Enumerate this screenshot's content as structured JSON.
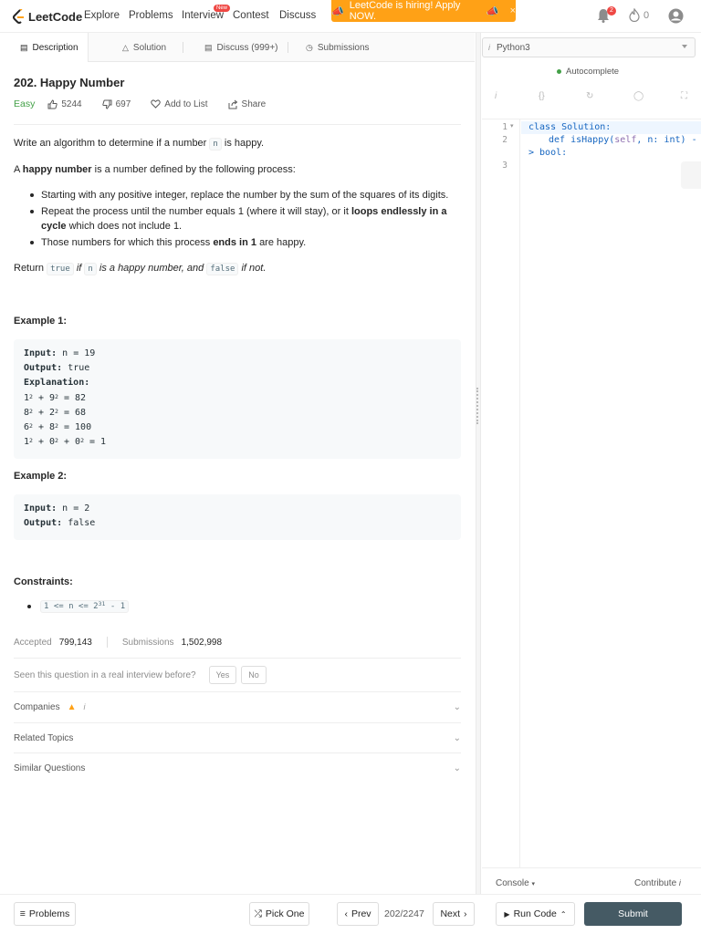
{
  "nav": {
    "brand": "LeetCode",
    "links": [
      "Explore",
      "Problems",
      "Interview",
      "Contest",
      "Discuss"
    ],
    "interview_badge": "New",
    "banner": "LeetCode is hiring! Apply NOW.",
    "notifications": "2",
    "streak": "0"
  },
  "tabs": [
    "Description",
    "Solution",
    "Discuss (999+)",
    "Submissions"
  ],
  "problem": {
    "title": "202. Happy Number",
    "difficulty": "Easy",
    "likes": "5244",
    "dislikes": "697",
    "add_to_list": "Add to List",
    "share": "Share",
    "intro_a": "Write an algorithm to determine if a number",
    "intro_code": "n",
    "intro_b": "is happy.",
    "def_bold": "happy number",
    "def_a": "A",
    "def_b": "is a number defined by the following process:",
    "bullet1": "Starting with any positive integer, replace the number by the sum of the squares of its digits.",
    "bullet2_a": "Repeat the process until the number equals 1 (where it will stay), or it",
    "bullet2_bold": "loops endlessly in a cycle",
    "bullet2_b": "which does not include 1.",
    "bullet3_a": "Those numbers for which this process",
    "bullet3_bold": "ends in 1",
    "bullet3_b": "are happy.",
    "return_a": "Return",
    "return_true": "true",
    "return_b": "if",
    "return_n": "n",
    "return_c": "is a happy number, and",
    "return_false": "false",
    "return_d": "if not."
  },
  "examples": [
    {
      "title": "Example 1:",
      "input_label": "Input:",
      "input": "n = 19",
      "output_label": "Output:",
      "output": "true",
      "explanation_label": "Explanation:"
    },
    {
      "title": "Example 2:",
      "input_label": "Input:",
      "input": "n = 2",
      "output_label": "Output:",
      "output": "false"
    }
  ],
  "constraints": {
    "title": "Constraints:",
    "text_a": "1 <= n <= 2",
    "exp": "31",
    "text_b": " - 1"
  },
  "stats": {
    "accepted_label": "Accepted",
    "accepted": "799,143",
    "submissions_label": "Submissions",
    "submissions": "1,502,998"
  },
  "seen": {
    "question": "Seen this question in a real interview before?",
    "yes": "Yes",
    "no": "No"
  },
  "accordions": [
    "Companies",
    "Related Topics",
    "Similar Questions"
  ],
  "editor": {
    "language": "Python3",
    "autocomplete": "Autocomplete",
    "line_numbers": [
      "1",
      "2",
      "3"
    ],
    "line1_kw": "class",
    "line1_name": "Solution:",
    "line2_kw": "def",
    "line2_fn": "isHappy(",
    "line2_self": "self",
    "line2_param": ", n:",
    "line2_type": "int",
    "line2_arrow": ") -",
    "line2b": "> bool:",
    "console": "Console",
    "contribute": "Contribute"
  },
  "footer": {
    "problems": "Problems",
    "pick_one": "Pick One",
    "prev": "Prev",
    "counter": "202/2247",
    "next": "Next",
    "run_code": "Run Code",
    "submit": "Submit"
  },
  "colors": {
    "brand": "#ffa116",
    "easy": "#43a047",
    "submit": "#455a64",
    "badge": "#ef4743"
  }
}
